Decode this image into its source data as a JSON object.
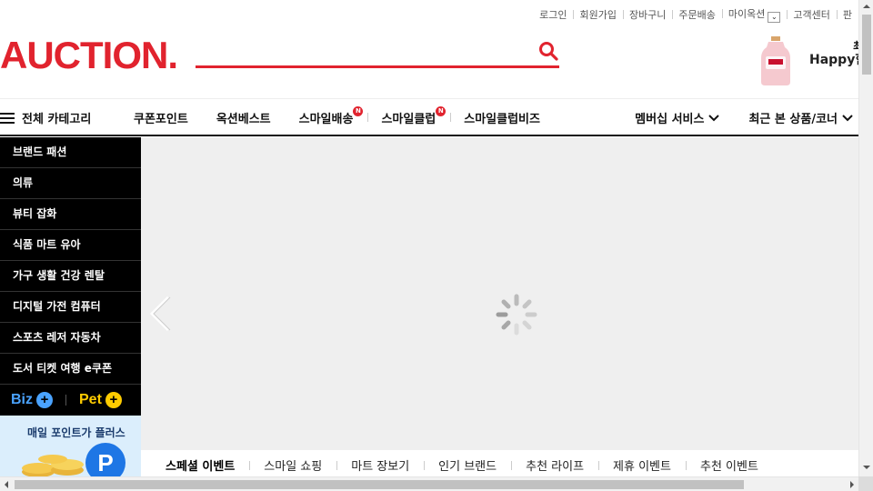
{
  "util_links": [
    "로그인",
    "회원가입",
    "장바구니",
    "주문배송",
    "마이옥션",
    "고객센터",
    "판"
  ],
  "header": {
    "logo": "AUCTION.",
    "search_value": "",
    "ad_line1": "최",
    "ad_line2": "Happy한"
  },
  "gnb": {
    "all_categories": "전체 카테고리",
    "menu": [
      {
        "label": "쿠폰포인트",
        "badge": ""
      },
      {
        "label": "옥션베스트",
        "badge": ""
      },
      {
        "label": "스마일배송",
        "badge": "N"
      },
      {
        "label": "스마일클럽",
        "badge": "N"
      },
      {
        "label": "스마일클럽비즈",
        "badge": ""
      }
    ],
    "right": [
      "멤버십 서비스",
      "최근 본 상품/코너"
    ]
  },
  "categories": [
    "브랜드 패션",
    "의류",
    "뷰티 잡화",
    "식품 마트 유아",
    "가구 생활 건강 렌탈",
    "디지털 가전 컴퓨터",
    "스포츠 레저 자동차",
    "도서 티켓 여행 e쿠폰"
  ],
  "bizpet": {
    "biz": "Biz",
    "pet": "Pet"
  },
  "promo": {
    "text": "매일 포인트가 플러스",
    "icon_letter": "P"
  },
  "tabs": [
    "스페셜 이벤트",
    "스마일 쇼핑",
    "마트 장보기",
    "인기 브랜드",
    "추천 라이프",
    "제휴 이벤트",
    "추천 이벤트"
  ],
  "colors": {
    "brand": "#e1232e",
    "category_bg": "#000000",
    "biz": "#4aa3ff",
    "pet": "#ffcc00"
  },
  "icons": [
    "search-icon",
    "hamburger-icon",
    "chevron-down-icon",
    "arrow-left-icon",
    "loading-spinner-icon",
    "plus-icon"
  ]
}
